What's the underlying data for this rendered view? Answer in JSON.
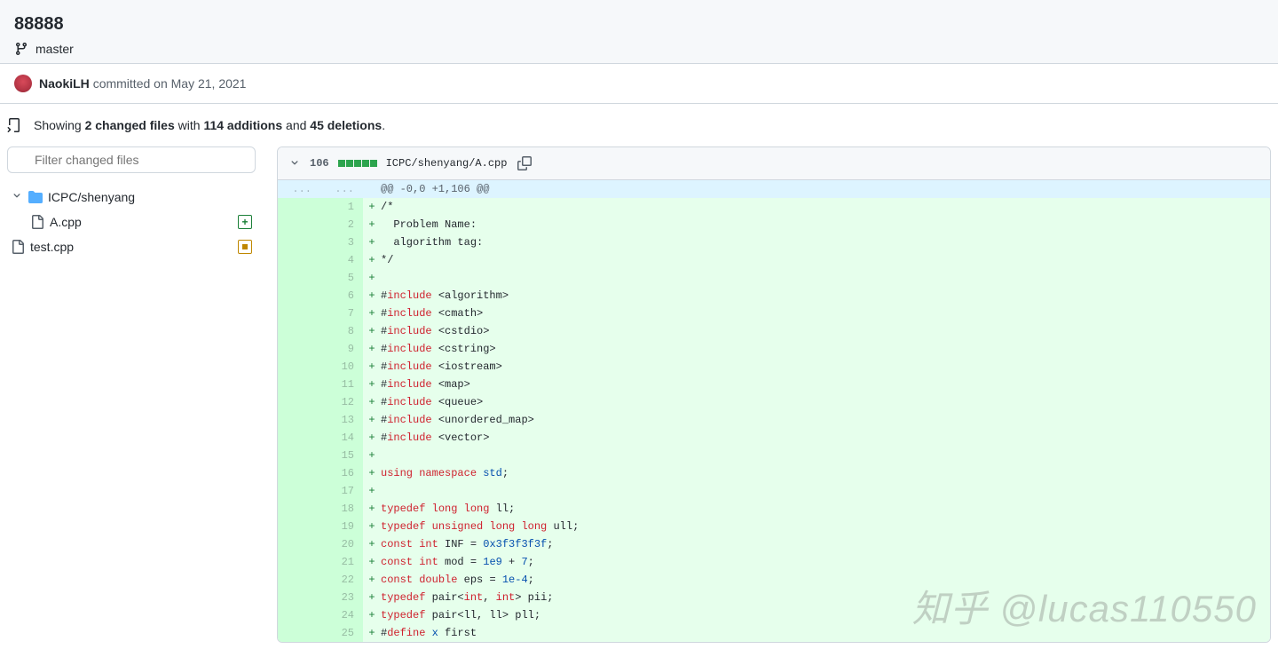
{
  "commit": {
    "title": "88888",
    "branch": "master",
    "author": "NaokiLH",
    "action": "committed",
    "date_prefix": "on",
    "date": "May 21, 2021"
  },
  "summary": {
    "prefix": "Showing",
    "changed_files": "2 changed files",
    "with": "with",
    "additions": "114 additions",
    "and": "and",
    "deletions": "45 deletions",
    "suffix": "."
  },
  "filter": {
    "placeholder": "Filter changed files"
  },
  "tree": {
    "folder": "ICPC/shenyang",
    "file1": "A.cpp",
    "file2": "test.cpp"
  },
  "diff": {
    "stat": "106",
    "path": "ICPC/shenyang/A.cpp",
    "hunk": "@@ -0,0 +1,106 @@",
    "lines": [
      {
        "n": "1",
        "tokens": [
          {
            "t": "/*"
          }
        ]
      },
      {
        "n": "2",
        "tokens": [
          {
            "t": "  Problem Name:"
          }
        ]
      },
      {
        "n": "3",
        "tokens": [
          {
            "t": "  algorithm tag:"
          }
        ]
      },
      {
        "n": "4",
        "tokens": [
          {
            "t": "*/"
          }
        ]
      },
      {
        "n": "5",
        "tokens": []
      },
      {
        "n": "6",
        "tokens": [
          {
            "t": "#"
          },
          {
            "t": "include",
            "c": "kw-include"
          },
          {
            "t": " <algorithm>"
          }
        ]
      },
      {
        "n": "7",
        "tokens": [
          {
            "t": "#"
          },
          {
            "t": "include",
            "c": "kw-include"
          },
          {
            "t": " <cmath>"
          }
        ]
      },
      {
        "n": "8",
        "tokens": [
          {
            "t": "#"
          },
          {
            "t": "include",
            "c": "kw-include"
          },
          {
            "t": " <cstdio>"
          }
        ]
      },
      {
        "n": "9",
        "tokens": [
          {
            "t": "#"
          },
          {
            "t": "include",
            "c": "kw-include"
          },
          {
            "t": " <cstring>"
          }
        ]
      },
      {
        "n": "10",
        "tokens": [
          {
            "t": "#"
          },
          {
            "t": "include",
            "c": "kw-include"
          },
          {
            "t": " <iostream>"
          }
        ]
      },
      {
        "n": "11",
        "tokens": [
          {
            "t": "#"
          },
          {
            "t": "include",
            "c": "kw-include"
          },
          {
            "t": " <map>"
          }
        ]
      },
      {
        "n": "12",
        "tokens": [
          {
            "t": "#"
          },
          {
            "t": "include",
            "c": "kw-include"
          },
          {
            "t": " <queue>"
          }
        ]
      },
      {
        "n": "13",
        "tokens": [
          {
            "t": "#"
          },
          {
            "t": "include",
            "c": "kw-include"
          },
          {
            "t": " <unordered_map>"
          }
        ]
      },
      {
        "n": "14",
        "tokens": [
          {
            "t": "#"
          },
          {
            "t": "include",
            "c": "kw-include"
          },
          {
            "t": " <vector>"
          }
        ]
      },
      {
        "n": "15",
        "tokens": []
      },
      {
        "n": "16",
        "tokens": [
          {
            "t": "using",
            "c": "kw-namespace"
          },
          {
            "t": " "
          },
          {
            "t": "namespace",
            "c": "kw-namespace"
          },
          {
            "t": " "
          },
          {
            "t": "std",
            "c": "kw-std"
          },
          {
            "t": ";"
          }
        ]
      },
      {
        "n": "17",
        "tokens": []
      },
      {
        "n": "18",
        "tokens": [
          {
            "t": "typedef",
            "c": "kw-type"
          },
          {
            "t": " "
          },
          {
            "t": "long",
            "c": "kw-type"
          },
          {
            "t": " "
          },
          {
            "t": "long",
            "c": "kw-type"
          },
          {
            "t": " ll;"
          }
        ]
      },
      {
        "n": "19",
        "tokens": [
          {
            "t": "typedef",
            "c": "kw-type"
          },
          {
            "t": " "
          },
          {
            "t": "unsigned",
            "c": "kw-type"
          },
          {
            "t": " "
          },
          {
            "t": "long",
            "c": "kw-type"
          },
          {
            "t": " "
          },
          {
            "t": "long",
            "c": "kw-type"
          },
          {
            "t": " ull;"
          }
        ]
      },
      {
        "n": "20",
        "tokens": [
          {
            "t": "const",
            "c": "kw-type"
          },
          {
            "t": " "
          },
          {
            "t": "int",
            "c": "kw-type"
          },
          {
            "t": " INF = "
          },
          {
            "t": "0x3f3f3f3f",
            "c": "kw-num"
          },
          {
            "t": ";"
          }
        ]
      },
      {
        "n": "21",
        "tokens": [
          {
            "t": "const",
            "c": "kw-type"
          },
          {
            "t": " "
          },
          {
            "t": "int",
            "c": "kw-type"
          },
          {
            "t": " mod = "
          },
          {
            "t": "1e9",
            "c": "kw-num"
          },
          {
            "t": " + "
          },
          {
            "t": "7",
            "c": "kw-num"
          },
          {
            "t": ";"
          }
        ]
      },
      {
        "n": "22",
        "tokens": [
          {
            "t": "const",
            "c": "kw-type"
          },
          {
            "t": " "
          },
          {
            "t": "double",
            "c": "kw-type"
          },
          {
            "t": " eps = "
          },
          {
            "t": "1e-4",
            "c": "kw-num"
          },
          {
            "t": ";"
          }
        ]
      },
      {
        "n": "23",
        "tokens": [
          {
            "t": "typedef",
            "c": "kw-type"
          },
          {
            "t": " pair<"
          },
          {
            "t": "int",
            "c": "kw-type"
          },
          {
            "t": ", "
          },
          {
            "t": "int",
            "c": "kw-type"
          },
          {
            "t": "> pii;"
          }
        ]
      },
      {
        "n": "24",
        "tokens": [
          {
            "t": "typedef",
            "c": "kw-type"
          },
          {
            "t": " pair<ll, ll> pll;"
          }
        ]
      },
      {
        "n": "25",
        "tokens": [
          {
            "t": "#"
          },
          {
            "t": "define",
            "c": "kw-include"
          },
          {
            "t": " "
          },
          {
            "t": "x",
            "c": "kw-builtin"
          },
          {
            "t": " first"
          }
        ]
      }
    ]
  },
  "watermark": "知乎 @lucas110550"
}
